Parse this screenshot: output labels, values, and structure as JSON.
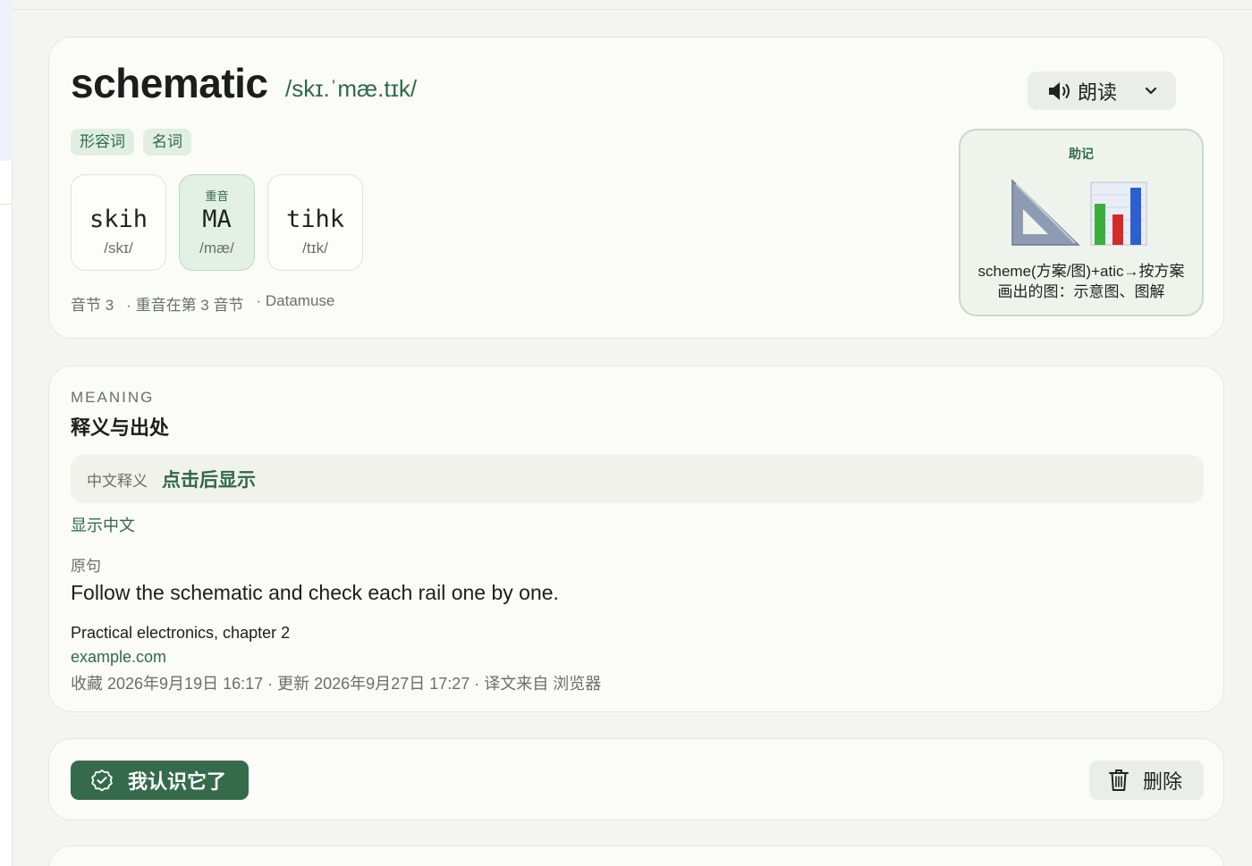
{
  "word": {
    "text": "schematic",
    "ipa": "/skɪ.ˈmæ.tɪk/",
    "read_label": "朗读",
    "tags": [
      "形容词",
      "名词"
    ],
    "syllables": [
      {
        "spelling": "skih",
        "phoneme": "/skɪ/",
        "stressed": false,
        "stress_label": ""
      },
      {
        "spelling": "MA",
        "phoneme": "/mæ/",
        "stressed": true,
        "stress_label": "重音"
      },
      {
        "spelling": "tihk",
        "phoneme": "/tɪk/",
        "stressed": false,
        "stress_label": ""
      }
    ],
    "meta": {
      "syllable_count": "音节 3",
      "stress_position": "· 重音在第 3 音节",
      "source": "· Datamuse"
    }
  },
  "mnemonic": {
    "title": "助记",
    "icons": [
      "set-square-icon",
      "bar-chart-icon"
    ],
    "text": "scheme(方案/图)+atic→按方案画出的图：示意图、图解"
  },
  "meaning": {
    "eyebrow": "MEANING",
    "title": "释义与出处",
    "zh_label": "中文释义",
    "zh_reveal": "点击后显示",
    "show_zh_link": "显示中文",
    "original_label": "原句",
    "original_sentence": "Follow the schematic and check each rail one by one.",
    "source_title": "Practical electronics, chapter 2",
    "source_link": "example.com",
    "timestamps": "收藏 2026年9月19日 16:17 · 更新 2026年9月27日 17:27 · 译文来自 浏览器"
  },
  "actions": {
    "know_label": "我认识它了",
    "delete_label": "删除"
  },
  "colors": {
    "accent": "#2e6a4a",
    "primary_button": "#356b4b",
    "card_bg": "#fbfcf7",
    "page_bg": "#f4f5f2"
  }
}
